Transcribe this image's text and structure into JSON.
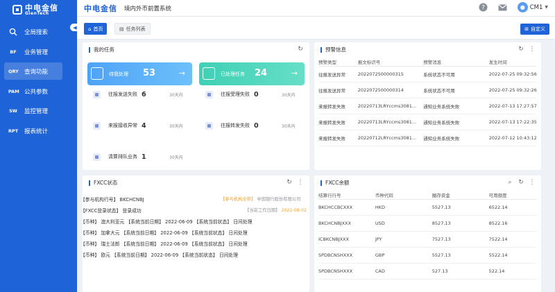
{
  "brand": {
    "logo_cn": "中电金信",
    "logo_en": "GienTech",
    "top_brand": "中电金信",
    "system_title": "境内外币前置系统"
  },
  "user": {
    "name": "CM1"
  },
  "colors": {
    "primary": "#1f63d8",
    "card_blue": "#4fa3f7",
    "card_teal": "#3fd0b5",
    "warning": "#e6a23c"
  },
  "sidebar": {
    "items": [
      {
        "icon": "search-icon",
        "code": "",
        "label": "全局搜索",
        "active": false
      },
      {
        "icon": "bf-icon",
        "code": "BF",
        "label": "业务管理",
        "active": false
      },
      {
        "icon": "qry-icon",
        "code": "QRY",
        "label": "查询功能",
        "active": true
      },
      {
        "icon": "pam-icon",
        "code": "PAM",
        "label": "公共参数",
        "active": false
      },
      {
        "icon": "sw-icon",
        "code": "SW",
        "label": "监控管理",
        "active": false
      },
      {
        "icon": "rpt-icon",
        "code": "RPT",
        "label": "报表统计",
        "active": false
      }
    ]
  },
  "tabs": {
    "home": "首页",
    "task_list": "任务列表",
    "customize": "自定义"
  },
  "my_tasks": {
    "title": "我的任务",
    "cards": [
      {
        "label": "待我处理",
        "value": "53"
      },
      {
        "label": "已处理任务",
        "value": "24"
      }
    ],
    "stats": [
      {
        "label": "往报发送失败",
        "value": "6",
        "sub": "30天内"
      },
      {
        "label": "往报受理失败",
        "value": "0",
        "sub": "30天内"
      },
      {
        "label": "来报接收异常",
        "value": "4",
        "sub": "30天内"
      },
      {
        "label": "往报转发失败",
        "value": "0",
        "sub": "30天内"
      },
      {
        "label": "清算排队业务",
        "value": "1",
        "sub": "30天内"
      }
    ]
  },
  "alerts": {
    "title": "预警信息",
    "headers": [
      "预警类型",
      "报文标识号",
      "预警消息",
      "发生时间"
    ],
    "rows": [
      [
        "往报发送异常",
        "2022072500000315",
        "系统状态不可用",
        "2022-07-25 09:32:56"
      ],
      [
        "往报发送异常",
        "2022072500000314",
        "系统状态不可用",
        "2022-07-25 09:32:26"
      ],
      [
        "来报转发失败",
        "20220713LRYccms3081...",
        "通知业务系统失败",
        "2022-07-13 17:27:57"
      ],
      [
        "来报转发失败",
        "20220713LRYccms3081...",
        "通知业务系统失败",
        "2022-07-13 17:22:35"
      ],
      [
        "来报转发失败",
        "20220712LRYccms3081...",
        "通知业务系统失败",
        "2022-07-12 10:43:12"
      ]
    ]
  },
  "fxcc_status": {
    "title": "FXCC状态",
    "lines": [
      {
        "text": "【参与机构行号】 BKCHCNBJ",
        "right_label": "【参与机构全称】",
        "right_value": "中国银行股份有限公司"
      },
      {
        "text": "【FXCC登录状态】 登录成功",
        "right_label": "【当前工作日期】",
        "right_value": "2022-08-02"
      },
      {
        "text": "【币种】 澳大利亚元 【系统当前日期】 2022-06-09 【系统当前状态】 日间处理"
      },
      {
        "text": "【币种】 加拿大元 【系统当前日期】 2022-06-09 【系统当前状态】 日间处理"
      },
      {
        "text": "【币种】 瑞士法郎 【系统当前日期】 2022-06-09 【系统当前状态】 日间处理"
      },
      {
        "text": "【币种】 欧元 【系统当前日期】 2022-06-09 【系统当前状态】 日间处理"
      }
    ]
  },
  "fxcc_balance": {
    "title": "FXCC余额",
    "headers": [
      "结算行行号",
      "币种代码",
      "圈存资金",
      "可用额度"
    ],
    "rows": [
      [
        "BKCHCCBCXXX",
        "HKD",
        "5527.13",
        "6522.14"
      ],
      [
        "BKCHCNBJXXX",
        "USD",
        "8527.13",
        "8522.16"
      ],
      [
        "ICBKCNBJXXX",
        "JPY",
        "7527.13",
        "7522.14"
      ],
      [
        "SPDBCNSHXXX",
        "GBP",
        "5527.13",
        "5522.14"
      ],
      [
        "SPDBCNSHXXX",
        "CAD",
        "527.13",
        "522.14"
      ]
    ]
  }
}
